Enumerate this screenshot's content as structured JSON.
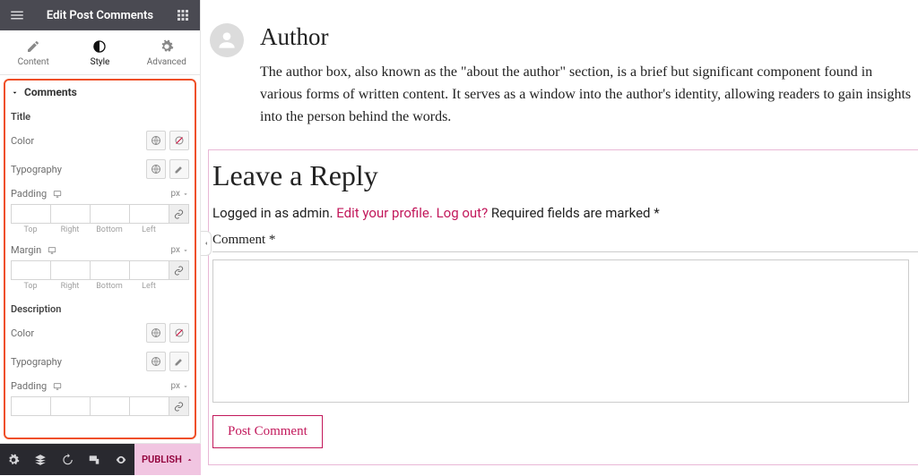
{
  "header": {
    "title": "Edit Post Comments"
  },
  "tabs": {
    "content": "Content",
    "style": "Style",
    "advanced": "Advanced"
  },
  "section": {
    "name": "Comments"
  },
  "title_group": {
    "heading": "Title",
    "color": "Color",
    "typography": "Typography",
    "padding": "Padding",
    "margin": "Margin",
    "unit": "px",
    "top": "Top",
    "right": "Right",
    "bottom": "Bottom",
    "left": "Left"
  },
  "desc_group": {
    "heading": "Description",
    "color": "Color",
    "typography": "Typography",
    "padding": "Padding",
    "unit": "px"
  },
  "footer": {
    "publish": "PUBLISH"
  },
  "preview": {
    "author_name": "Author",
    "author_bio": "The author box, also known as the \"about the author\" section, is a brief but significant component found in various forms of written content. It serves as a window into the author's identity, allowing readers to gain insights into the person behind the words.",
    "reply_title": "Leave a Reply",
    "logged_in_pre": "Logged in as admin. ",
    "edit_profile": "Edit your profile.",
    "logout": "Log out?",
    "required": " Required fields are marked *",
    "comment_label": "Comment *",
    "post_comment": "Post Comment"
  }
}
